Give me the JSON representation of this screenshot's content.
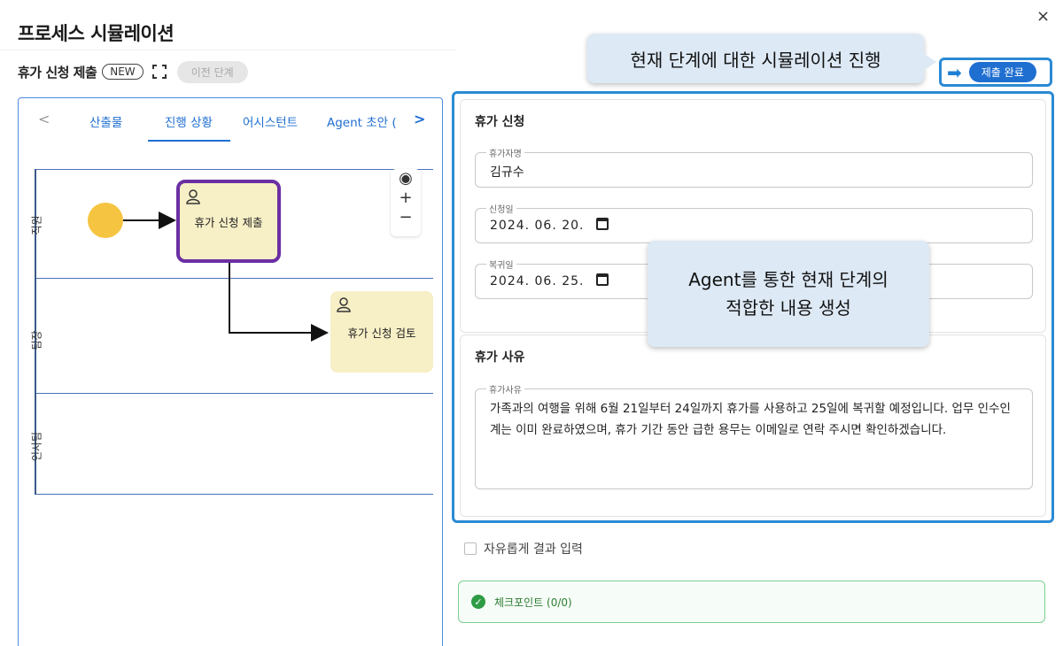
{
  "dialog": {
    "title": "프로세스 시뮬레이션",
    "close_label": "×"
  },
  "subheader": {
    "task_name": "휴가 신청 제출",
    "badge": "NEW",
    "prev_step_label": "이전 단계"
  },
  "tooltips": {
    "simulation": "현재 단계에 대한 시뮬레이션 진행",
    "agent_line1": "Agent를 통한 현재 단계의",
    "agent_line2": "적합한 내용 생성"
  },
  "submit": {
    "label": "제출 완료"
  },
  "tabs": {
    "items": [
      "산출물",
      "진행 상황",
      "어시스턴트",
      "Agent 초안 ("
    ],
    "active": "진행 상황"
  },
  "diagram": {
    "lanes": [
      "직원",
      "팀장",
      "인사팀"
    ],
    "task1": "휴가 신청 제출",
    "task2": "휴가 신청 검토"
  },
  "form": {
    "card1_title": "휴가 신청",
    "name_label": "휴가자명",
    "name_value": "김규수",
    "apply_label": "신청일",
    "apply_value": "2024. 06. 20.",
    "return_label": "복귀일",
    "return_value": "2024. 06. 25.",
    "card2_title": "휴가 사유",
    "reason_label": "휴가사유",
    "reason_value": "가족과의 여행을 위해 6월 21일부터 24일까지 휴가를 사용하고 25일에 복귀할 예정입니다. 업무 인수인계는 이미 완료하였으며, 휴가 기간 동안 급한 용무는 이메일로 연락 주시면 확인하겠습니다."
  },
  "options": {
    "free_input_label": "자유롭게 결과 입력",
    "checkpoint_label": "체크포인트 (0/0)"
  },
  "colors": {
    "accent": "#1f6fd1",
    "highlight_border": "#2a8ad4",
    "active_task_border": "#6b2fa3",
    "task_fill": "#f7efc6",
    "start_event": "#f5c542",
    "checkpoint_green": "#2e9b45"
  }
}
